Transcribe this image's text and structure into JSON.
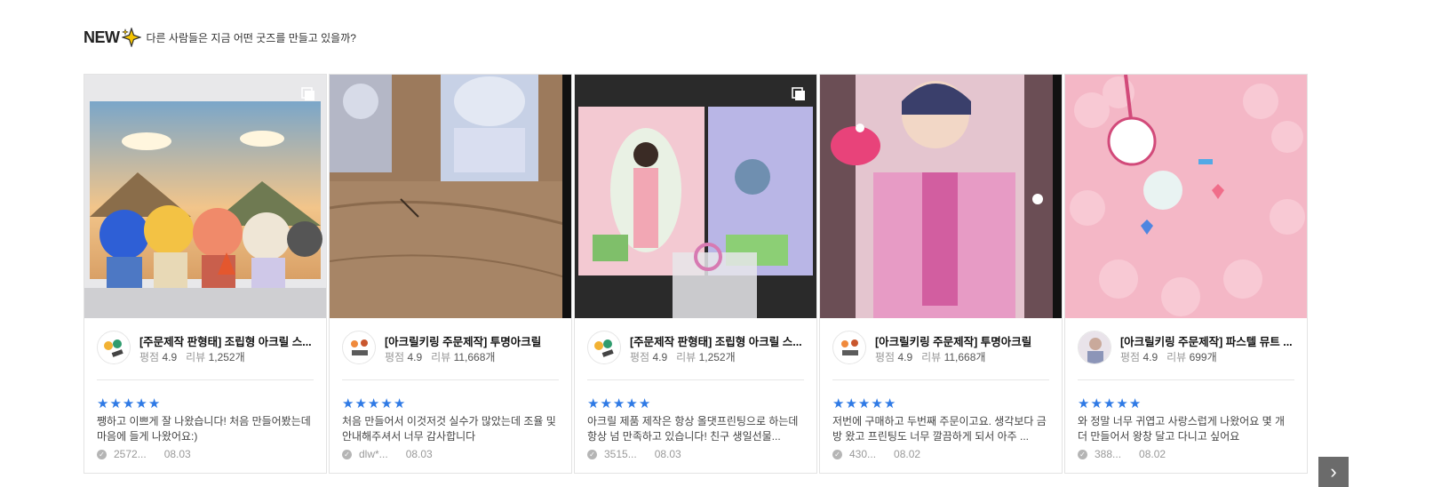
{
  "header": {
    "badge": "NEW",
    "subtitle": "다른 사람들은 지금 어떤 굿즈를 만들고 있을까?"
  },
  "cards": [
    {
      "title": "[주문제작 판형태] 조립형 아크릴 스...",
      "rating_label": "평점",
      "rating": "4.9",
      "review_label": "리뷰",
      "review_count": "1,252개",
      "stars": 5,
      "review": "쨍하고 이쁘게 잘 나왔습니다! 처음 만들어봤는데 마음에 들게 나왔어요:)",
      "author": "2572...",
      "date": "08.03",
      "multi_image": true
    },
    {
      "title": "[아크릴키링 주문제작] 투명아크릴",
      "rating_label": "평점",
      "rating": "4.9",
      "review_label": "리뷰",
      "review_count": "11,668개",
      "stars": 5,
      "review": "처음 만들어서 이것저것 실수가 많았는데 조율 및 안내해주셔서 너무 감사합니다",
      "author": "dlw*...",
      "date": "08.03",
      "multi_image": false
    },
    {
      "title": "[주문제작 판형태] 조립형 아크릴 스...",
      "rating_label": "평점",
      "rating": "4.9",
      "review_label": "리뷰",
      "review_count": "1,252개",
      "stars": 5,
      "review": "아크릴 제품 제작은 항상 올댓프린팅으로 하는데 항상 넘 만족하고 있습니다! 친구 생일선물...",
      "author": "3515...",
      "date": "08.03",
      "multi_image": true
    },
    {
      "title": "[아크릴키링 주문제작] 투명아크릴",
      "rating_label": "평점",
      "rating": "4.9",
      "review_label": "리뷰",
      "review_count": "11,668개",
      "stars": 5,
      "review": "저번에 구매하고 두번째 주문이고요. 생각보다 금방 왔고 프린팅도 너무 깔끔하게 되서 아주 ...",
      "author": "430...",
      "date": "08.02",
      "multi_image": false
    },
    {
      "title": "[아크릴키링 주문제작] 파스텔 뮤트 ...",
      "rating_label": "평점",
      "rating": "4.9",
      "review_label": "리뷰",
      "review_count": "699개",
      "stars": 5,
      "review": "와 정말 너무 귀엽고 사랑스럽게 나왔어요 몇 개 더 만들어서 왕창 달고 다니고 싶어요",
      "author": "388...",
      "date": "08.02",
      "multi_image": false
    }
  ],
  "next_button": "›",
  "colors": {
    "star": "#2f7ae5",
    "accent_sparkle": "#f5c400",
    "next_button_bg": "#6b6b6b"
  }
}
